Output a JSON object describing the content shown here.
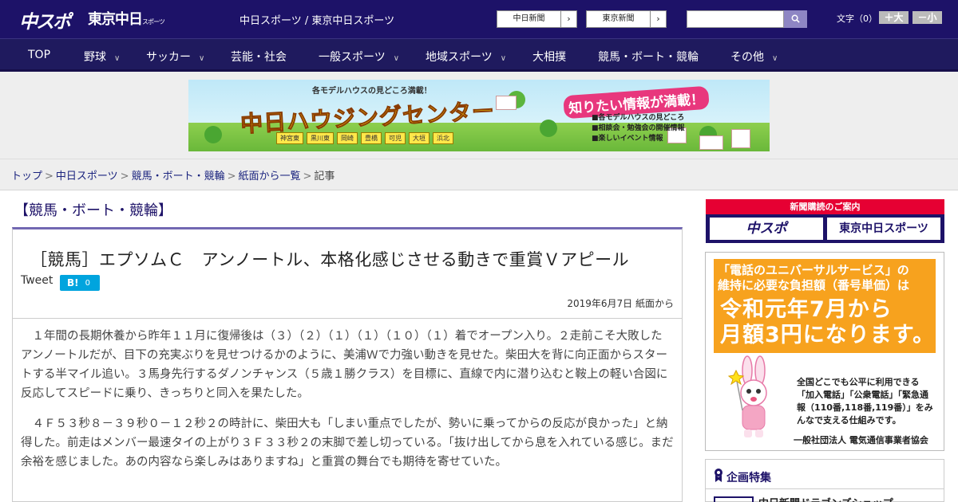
{
  "header": {
    "logo_chunichi": "中スポ",
    "logo_tokyo": "東京中日",
    "logo_tokyo_small": "スポーツ",
    "site_name": "中日スポーツ / 東京中日スポーツ",
    "ext_links": [
      "中日新聞",
      "東京新聞"
    ],
    "search_placeholder": "",
    "search_icon": "search-icon",
    "text_size_label": "文字（0）",
    "text_bigger": "＋大",
    "text_smaller": "－小"
  },
  "nav": {
    "items": [
      {
        "label": "TOP",
        "has_dropdown": false
      },
      {
        "label": "野球",
        "has_dropdown": true
      },
      {
        "label": "サッカー",
        "has_dropdown": true
      },
      {
        "label": "芸能・社会",
        "has_dropdown": false
      },
      {
        "label": "一般スポーツ",
        "has_dropdown": true
      },
      {
        "label": "地域スポーツ",
        "has_dropdown": true
      },
      {
        "label": "大相撲",
        "has_dropdown": false
      },
      {
        "label": "競馬・ボート・競輪",
        "has_dropdown": false
      },
      {
        "label": "その他",
        "has_dropdown": true
      }
    ],
    "chevron": "∨"
  },
  "banner": {
    "top_text": "各モデルハウスの見どころ満載！",
    "title": "中日ハウジングセンター",
    "right_title": "知りたい情報が満載！",
    "right_list": [
      "■各モデルハウスの見どころ",
      "■相談会・勉強会の開催情報",
      "■楽しいイベント情報"
    ],
    "tags": [
      "神宮東",
      "黒川東",
      "岡崎",
      "豊橋",
      "可児",
      "大垣",
      "浜北"
    ]
  },
  "breadcrumb": {
    "items": [
      "トップ",
      "中日スポーツ",
      "競馬・ボート・競輪",
      "紙面から一覧",
      "記事"
    ],
    "separator": ">"
  },
  "article": {
    "category": "【競馬・ボート・競輪】",
    "headline": "［競馬］エプソムＣ　アンノートル、本格化感じさせる動きで重賞Ｖアピール",
    "tweet_label": "Tweet",
    "hatena_label": "B!",
    "hatena_count": "0",
    "date": "2019年6月7日 紙面から",
    "paragraphs": [
      "　１年間の長期休養から昨年１１月に復帰後は（３）（２）（１）（１）（１０）（１）着でオープン入り。２走前こそ大敗したアンノートルだが、目下の充実ぶりを見せつけるかのように、美浦Ｗで力強い動きを見せた。柴田大を背に向正面からスタートする半マイル追い。３馬身先行するダノンチャンス（５歳１勝クラス）を目標に、直線で内に潜り込むと鞍上の軽い合図に反応してスピードに乗り、きっちりと同入を果たした。",
      "　４Ｆ５３秒８－３９秒０－１２秒２の時計に、柴田大も「しまい重点でしたが、勢いに乗ってからの反応が良かった」と納得した。前走はメンバー最速タイの上がり３Ｆ３３秒２の末脚で差し切っている。「抜け出してから息を入れている感じ。まだ余裕を感じました。あの内容なら楽しみはありますね」と重賞の舞台でも期待を寄せていた。"
    ]
  },
  "sidebar": {
    "subscribe_head": "新聞購読のご案内",
    "subscribe_buttons": [
      "中スポ",
      "東京中日スポーツ"
    ],
    "ad": {
      "top_line1_pre": "「電話のユニバーサルサービス」の",
      "top_line2": "維持に必要な負担額（番号単価）は",
      "big_line1": "令和元年7月から",
      "big_line2": "月額3円になります。",
      "desc": "全国どこでも公平に利用できる「加入電話」「公衆電話」「緊急通報（110番,118番,119番）」をみんなで支える仕組みです。",
      "org": "一般社団法人 電気通信事業者協会"
    },
    "feature_title": "企画特集",
    "feature_item": "中日新聞ドラゴンズショップ"
  },
  "colors": {
    "header_bg": "#1d1268",
    "accent_red": "#e60033",
    "article_rule": "#7268b2",
    "hatena": "#00a4de",
    "ad_orange": "#f7a21e"
  }
}
